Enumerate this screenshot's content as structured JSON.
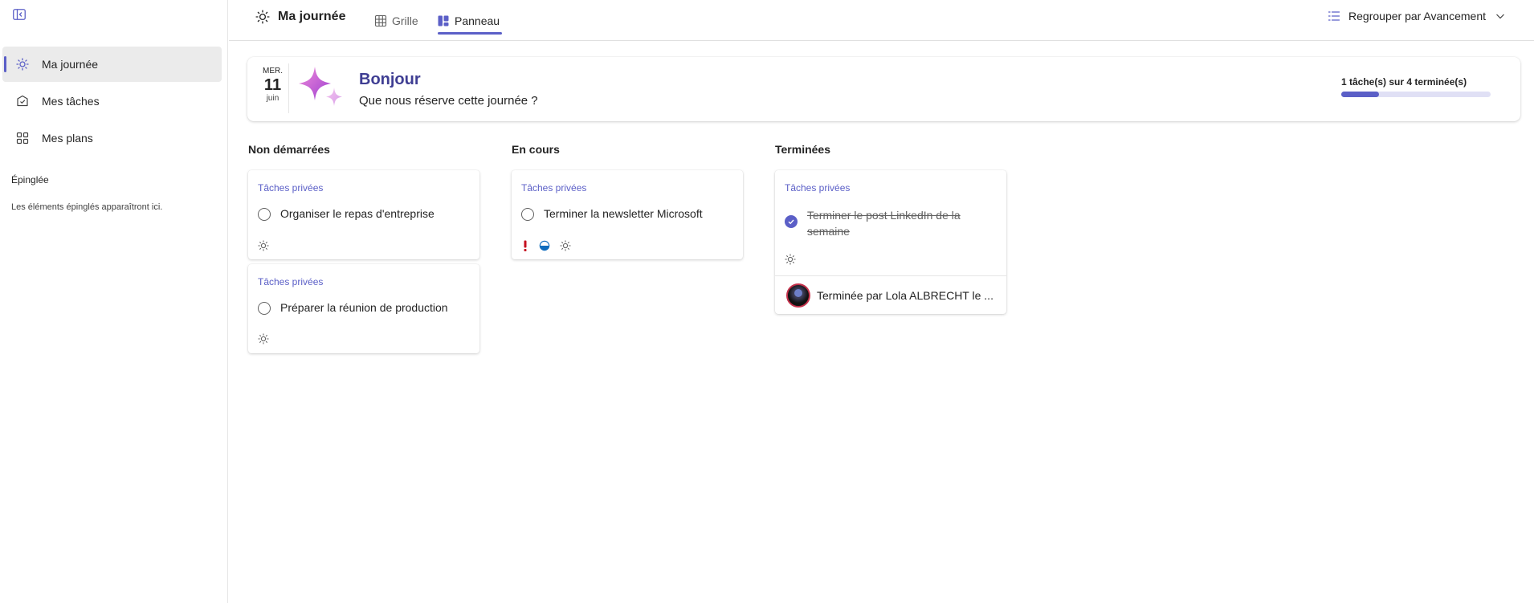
{
  "sidebar": {
    "collapse_icon": "panel-collapse-icon",
    "items": [
      {
        "label": "Ma journée",
        "icon": "sun-icon",
        "active": true
      },
      {
        "label": "Mes tâches",
        "icon": "tasks-icon",
        "active": false
      },
      {
        "label": "Mes plans",
        "icon": "grid-apps-icon",
        "active": false
      }
    ],
    "pinned_title": "Épinglée",
    "pinned_empty": "Les éléments épinglés apparaîtront ici."
  },
  "topbar": {
    "title": "Ma journée",
    "tabs": [
      {
        "label": "Grille",
        "icon": "table-icon",
        "active": false
      },
      {
        "label": "Panneau",
        "icon": "board-icon",
        "active": true
      }
    ],
    "group_by": "Regrouper par Avancement"
  },
  "greeting": {
    "day_of_week": "MER.",
    "day": "11",
    "month": "juin",
    "title": "Bonjour",
    "subtitle": "Que nous réserve cette journée ?",
    "progress_label": "1 tâche(s) sur 4 terminée(s)",
    "progress_fraction": 0.25
  },
  "columns": [
    {
      "title": "Non démarrées",
      "cards": [
        {
          "plan": "Tâches privées",
          "title": "Organiser le repas d'entreprise"
        },
        {
          "plan": "Tâches privées",
          "title": "Préparer la réunion de production"
        }
      ]
    },
    {
      "title": "En cours",
      "cards": [
        {
          "plan": "Tâches privées",
          "title": "Terminer la newsletter Microsoft"
        }
      ]
    },
    {
      "title": "Terminées",
      "cards": [
        {
          "plan": "Tâches privées",
          "title": "Terminer le post LinkedIn de la semaine",
          "completed_by": "Terminée par Lola ALBRECHT le ..."
        }
      ]
    }
  ],
  "colors": {
    "accent": "#5b5fc7",
    "title_accent": "#3f3e93",
    "priority_urgent": "#c50f1f"
  }
}
